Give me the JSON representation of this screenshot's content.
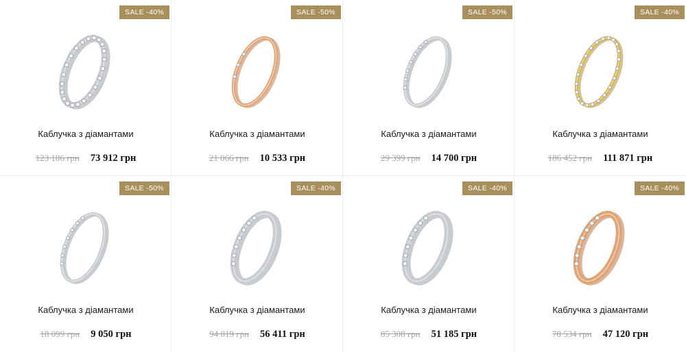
{
  "products": [
    {
      "badge": "SALE -40%",
      "title": "Каблучка з діамантами",
      "old_price": "123 186 грн",
      "price": "73 912 грн",
      "metal": "white",
      "style": "wide"
    },
    {
      "badge": "SALE -50%",
      "title": "Каблучка з діамантами",
      "old_price": "21 066 грн",
      "price": "10 533 грн",
      "metal": "rose",
      "style": "solitaire"
    },
    {
      "badge": "SALE -50%",
      "title": "Каблучка з діамантами",
      "old_price": "29 399 грн",
      "price": "14 700 грн",
      "metal": "white",
      "style": "half"
    },
    {
      "badge": "SALE -40%",
      "title": "Каблучка з діамантами",
      "old_price": "186 452 грн",
      "price": "111 871 грн",
      "metal": "yellow",
      "style": "eternity"
    },
    {
      "badge": "SALE -50%",
      "title": "Каблучка з діамантами",
      "old_price": "18 099 грн",
      "price": "9 050 грн",
      "metal": "white",
      "style": "half"
    },
    {
      "badge": "SALE -40%",
      "title": "Каблучка з діамантами",
      "old_price": "94 019 грн",
      "price": "56 411 грн",
      "metal": "white",
      "style": "half-wide"
    },
    {
      "badge": "SALE -40%",
      "title": "Каблучка з діамантами",
      "old_price": "85 308 грн",
      "price": "51 185 грн",
      "metal": "white",
      "style": "half-wide"
    },
    {
      "badge": "SALE -40%",
      "title": "Каблучка з діамантами",
      "old_price": "78 534 грн",
      "price": "47 120 грн",
      "metal": "rose",
      "style": "band"
    }
  ],
  "colors": {
    "badge": "#a98f5c",
    "white_metal": "#c9ccd0",
    "rose_metal": "#e0a577",
    "yellow_metal": "#d8b756"
  }
}
